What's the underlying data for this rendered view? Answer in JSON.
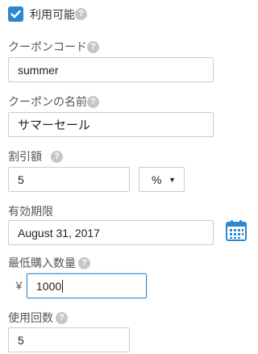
{
  "availability": {
    "label": "利用可能",
    "checked": true,
    "help_icon": "question-circle-icon"
  },
  "coupon_code": {
    "label": "クーポンコード",
    "value": "summer",
    "help_icon": "question-circle-icon"
  },
  "coupon_name": {
    "label": "クーポンの名前",
    "value": "サマーセール",
    "help_icon": "question-circle-icon"
  },
  "discount": {
    "label": "割引額",
    "value": "5",
    "unit_selected": "%",
    "help_icon": "question-circle-icon"
  },
  "expiry": {
    "label": "有効期限",
    "value": "August 31, 2017",
    "calendar_icon": "calendar-icon"
  },
  "min_purchase": {
    "label": "最低購入数量",
    "currency_symbol": "￥",
    "value": "1000",
    "help_icon": "question-circle-icon"
  },
  "usage_count": {
    "label": "使用回数",
    "value": "5",
    "help_icon": "question-circle-icon"
  },
  "colors": {
    "accent": "#2b87d1",
    "help_icon": "#c6c6c6",
    "border": "#cccccc"
  }
}
